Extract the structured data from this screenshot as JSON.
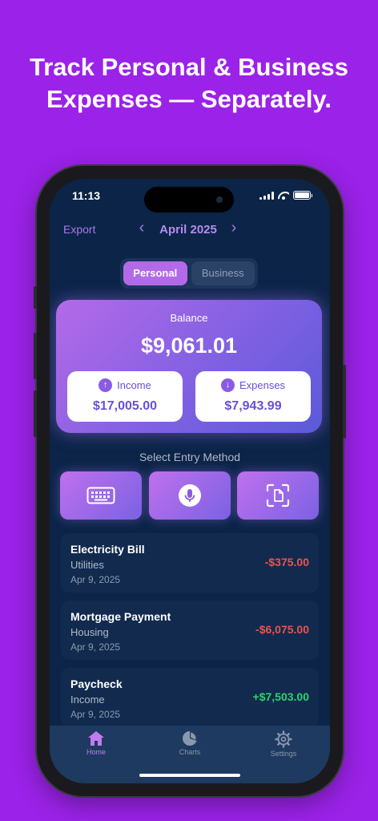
{
  "headline": {
    "line1": "Track Personal & Business",
    "line2": "Expenses — Separately."
  },
  "status": {
    "time": "11:13"
  },
  "nav": {
    "export_label": "Export",
    "month": "April 2025",
    "prev_glyph": "‹",
    "next_glyph": "›"
  },
  "segment": {
    "options": [
      "Personal",
      "Business"
    ],
    "selected": "Personal"
  },
  "balance": {
    "label": "Balance",
    "value": "$9,061.01",
    "income": {
      "label": "Income",
      "value": "$17,005.00",
      "icon": "arrow-up-icon"
    },
    "expenses": {
      "label": "Expenses",
      "value": "$7,943.99",
      "icon": "arrow-down-icon"
    }
  },
  "entry": {
    "title": "Select Entry Method",
    "methods": [
      "keyboard-icon",
      "microphone-icon",
      "document-scan-icon"
    ]
  },
  "transactions": [
    {
      "name": "Electricity Bill",
      "category": "Utilities",
      "date": "Apr 9, 2025",
      "amount": "-$375.00",
      "type": "expense"
    },
    {
      "name": "Mortgage Payment",
      "category": "Housing",
      "date": "Apr 9, 2025",
      "amount": "-$6,075.00",
      "type": "expense"
    },
    {
      "name": "Paycheck",
      "category": "Income",
      "date": "Apr 9, 2025",
      "amount": "+$7,503.00",
      "type": "income"
    }
  ],
  "tabs": [
    {
      "label": "Home",
      "icon": "home-icon",
      "active": true
    },
    {
      "label": "Charts",
      "icon": "pie-chart-icon",
      "active": false
    },
    {
      "label": "Settings",
      "icon": "gear-icon",
      "active": false
    }
  ],
  "colors": {
    "background": "#9b22e8",
    "screen": "#0b2447",
    "accent": "#b36ae8",
    "expense": "#f0524c",
    "income": "#2ed16a"
  }
}
